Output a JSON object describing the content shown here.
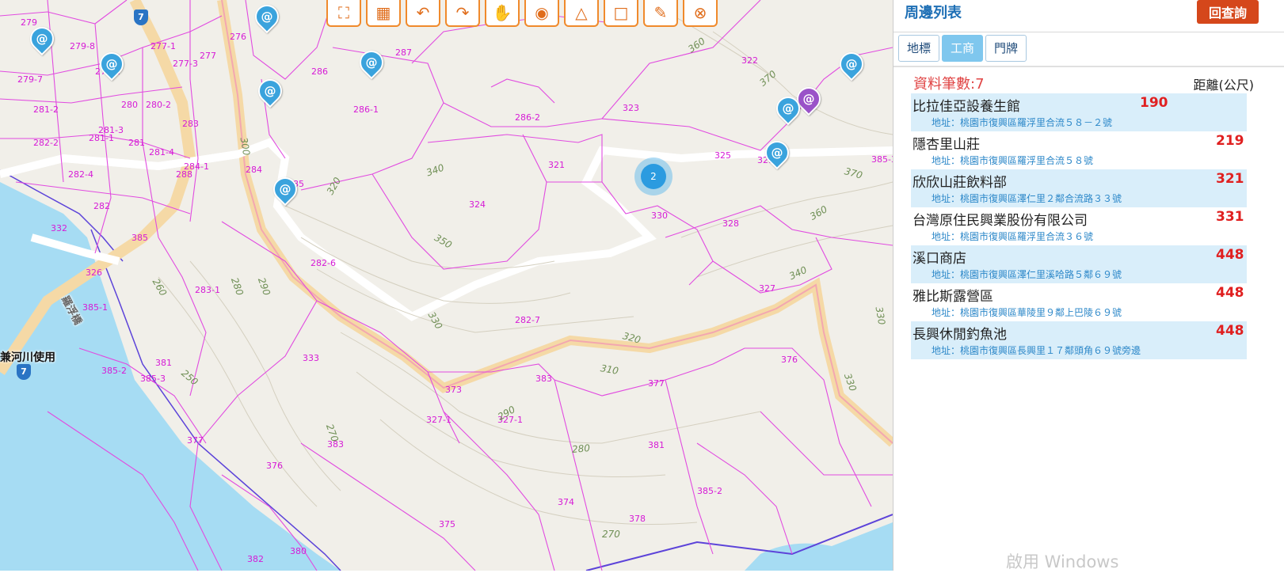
{
  "panel": {
    "title": "周邊列表",
    "back_button": "回查詢",
    "tabs": [
      {
        "label": "地標",
        "active": false
      },
      {
        "label": "工商",
        "active": true
      },
      {
        "label": "門牌",
        "active": false
      }
    ],
    "count_label": "資料筆數:",
    "count_value": "7",
    "distance_header": "距離(公尺)",
    "results": [
      {
        "name": "比拉佳亞設養生館",
        "distance": "190",
        "address": "地址：桃園市復興區羅浮里合流５８－２號"
      },
      {
        "name": "隱杏里山莊",
        "distance": "219",
        "address": "地址：桃園市復興區羅浮里合流５８號"
      },
      {
        "name": "欣欣山莊飲料部",
        "distance": "321",
        "address": "地址：桃園市復興區澤仁里２鄰合流路３３號"
      },
      {
        "name": "台灣原住民興業股份有限公司",
        "distance": "331",
        "address": "地址：桃園市復興區羅浮里合流３６號"
      },
      {
        "name": "溪口商店",
        "distance": "448",
        "address": "地址：桃園市復興區澤仁里溪哈路５鄰６９號"
      },
      {
        "name": "雅比斯露營區",
        "distance": "448",
        "address": "地址：桃園市復興區華陵里９鄰上巴陵６９號"
      },
      {
        "name": "長興休閒釣魚池",
        "distance": "448",
        "address": "地址：桃園市復興區長興里１７鄰頭角６９號旁邊"
      }
    ],
    "watermark": "啟用 Windows"
  },
  "map": {
    "toolbar_icons": [
      "zoom-extent-icon",
      "building-icon",
      "rotate-left-icon",
      "rotate-right-icon",
      "pan-hand-icon",
      "measure-distance-icon",
      "measure-angle-icon",
      "measure-area-icon",
      "eraser-icon",
      "clear-location-icon"
    ],
    "cluster_count": "2",
    "road_shield": "7",
    "river_label": "兼河川使用",
    "bridge_label": "羅浮橋",
    "parcels": [
      "279",
      "279-8",
      "279-2",
      "279-7",
      "277-1",
      "277-3",
      "277",
      "276",
      "286",
      "287",
      "286-1",
      "281-2",
      "280",
      "280-2",
      "281-3",
      "283",
      "282-2",
      "281-1",
      "281",
      "281-4",
      "284-1",
      "288",
      "284",
      "285",
      "282-4",
      "282",
      "286-2",
      "323",
      "322",
      "321",
      "324",
      "325",
      "329",
      "330",
      "328",
      "332",
      "385",
      "282-6",
      "326",
      "385-1",
      "283-1",
      "282-7",
      "327",
      "333",
      "381",
      "385-2",
      "385-3",
      "383",
      "377",
      "376",
      "373",
      "327-1",
      "327-1",
      "377",
      "383",
      "381",
      "376",
      "385-2",
      "374",
      "378",
      "375",
      "380",
      "382",
      "385-3",
      "370"
    ],
    "contours": [
      "360",
      "370",
      "300",
      "340",
      "320",
      "350",
      "260",
      "280",
      "290",
      "330",
      "320",
      "310",
      "250",
      "290",
      "280",
      "270",
      "370",
      "360",
      "340",
      "330",
      "330",
      "270"
    ]
  }
}
